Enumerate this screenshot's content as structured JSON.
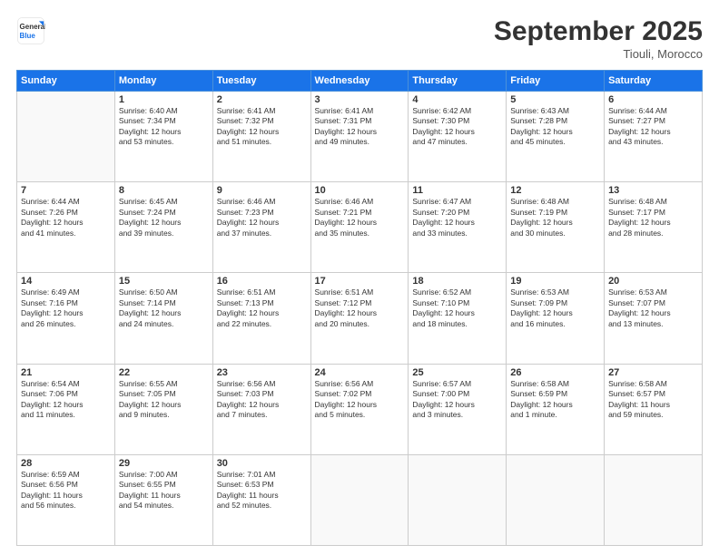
{
  "header": {
    "logo_line1": "General",
    "logo_line2": "Blue",
    "month": "September 2025",
    "location": "Tiouli, Morocco"
  },
  "weekdays": [
    "Sunday",
    "Monday",
    "Tuesday",
    "Wednesday",
    "Thursday",
    "Friday",
    "Saturday"
  ],
  "weeks": [
    [
      {
        "day": "",
        "info": ""
      },
      {
        "day": "1",
        "info": "Sunrise: 6:40 AM\nSunset: 7:34 PM\nDaylight: 12 hours\nand 53 minutes."
      },
      {
        "day": "2",
        "info": "Sunrise: 6:41 AM\nSunset: 7:32 PM\nDaylight: 12 hours\nand 51 minutes."
      },
      {
        "day": "3",
        "info": "Sunrise: 6:41 AM\nSunset: 7:31 PM\nDaylight: 12 hours\nand 49 minutes."
      },
      {
        "day": "4",
        "info": "Sunrise: 6:42 AM\nSunset: 7:30 PM\nDaylight: 12 hours\nand 47 minutes."
      },
      {
        "day": "5",
        "info": "Sunrise: 6:43 AM\nSunset: 7:28 PM\nDaylight: 12 hours\nand 45 minutes."
      },
      {
        "day": "6",
        "info": "Sunrise: 6:44 AM\nSunset: 7:27 PM\nDaylight: 12 hours\nand 43 minutes."
      }
    ],
    [
      {
        "day": "7",
        "info": "Sunrise: 6:44 AM\nSunset: 7:26 PM\nDaylight: 12 hours\nand 41 minutes."
      },
      {
        "day": "8",
        "info": "Sunrise: 6:45 AM\nSunset: 7:24 PM\nDaylight: 12 hours\nand 39 minutes."
      },
      {
        "day": "9",
        "info": "Sunrise: 6:46 AM\nSunset: 7:23 PM\nDaylight: 12 hours\nand 37 minutes."
      },
      {
        "day": "10",
        "info": "Sunrise: 6:46 AM\nSunset: 7:21 PM\nDaylight: 12 hours\nand 35 minutes."
      },
      {
        "day": "11",
        "info": "Sunrise: 6:47 AM\nSunset: 7:20 PM\nDaylight: 12 hours\nand 33 minutes."
      },
      {
        "day": "12",
        "info": "Sunrise: 6:48 AM\nSunset: 7:19 PM\nDaylight: 12 hours\nand 30 minutes."
      },
      {
        "day": "13",
        "info": "Sunrise: 6:48 AM\nSunset: 7:17 PM\nDaylight: 12 hours\nand 28 minutes."
      }
    ],
    [
      {
        "day": "14",
        "info": "Sunrise: 6:49 AM\nSunset: 7:16 PM\nDaylight: 12 hours\nand 26 minutes."
      },
      {
        "day": "15",
        "info": "Sunrise: 6:50 AM\nSunset: 7:14 PM\nDaylight: 12 hours\nand 24 minutes."
      },
      {
        "day": "16",
        "info": "Sunrise: 6:51 AM\nSunset: 7:13 PM\nDaylight: 12 hours\nand 22 minutes."
      },
      {
        "day": "17",
        "info": "Sunrise: 6:51 AM\nSunset: 7:12 PM\nDaylight: 12 hours\nand 20 minutes."
      },
      {
        "day": "18",
        "info": "Sunrise: 6:52 AM\nSunset: 7:10 PM\nDaylight: 12 hours\nand 18 minutes."
      },
      {
        "day": "19",
        "info": "Sunrise: 6:53 AM\nSunset: 7:09 PM\nDaylight: 12 hours\nand 16 minutes."
      },
      {
        "day": "20",
        "info": "Sunrise: 6:53 AM\nSunset: 7:07 PM\nDaylight: 12 hours\nand 13 minutes."
      }
    ],
    [
      {
        "day": "21",
        "info": "Sunrise: 6:54 AM\nSunset: 7:06 PM\nDaylight: 12 hours\nand 11 minutes."
      },
      {
        "day": "22",
        "info": "Sunrise: 6:55 AM\nSunset: 7:05 PM\nDaylight: 12 hours\nand 9 minutes."
      },
      {
        "day": "23",
        "info": "Sunrise: 6:56 AM\nSunset: 7:03 PM\nDaylight: 12 hours\nand 7 minutes."
      },
      {
        "day": "24",
        "info": "Sunrise: 6:56 AM\nSunset: 7:02 PM\nDaylight: 12 hours\nand 5 minutes."
      },
      {
        "day": "25",
        "info": "Sunrise: 6:57 AM\nSunset: 7:00 PM\nDaylight: 12 hours\nand 3 minutes."
      },
      {
        "day": "26",
        "info": "Sunrise: 6:58 AM\nSunset: 6:59 PM\nDaylight: 12 hours\nand 1 minute."
      },
      {
        "day": "27",
        "info": "Sunrise: 6:58 AM\nSunset: 6:57 PM\nDaylight: 11 hours\nand 59 minutes."
      }
    ],
    [
      {
        "day": "28",
        "info": "Sunrise: 6:59 AM\nSunset: 6:56 PM\nDaylight: 11 hours\nand 56 minutes."
      },
      {
        "day": "29",
        "info": "Sunrise: 7:00 AM\nSunset: 6:55 PM\nDaylight: 11 hours\nand 54 minutes."
      },
      {
        "day": "30",
        "info": "Sunrise: 7:01 AM\nSunset: 6:53 PM\nDaylight: 11 hours\nand 52 minutes."
      },
      {
        "day": "",
        "info": ""
      },
      {
        "day": "",
        "info": ""
      },
      {
        "day": "",
        "info": ""
      },
      {
        "day": "",
        "info": ""
      }
    ]
  ]
}
